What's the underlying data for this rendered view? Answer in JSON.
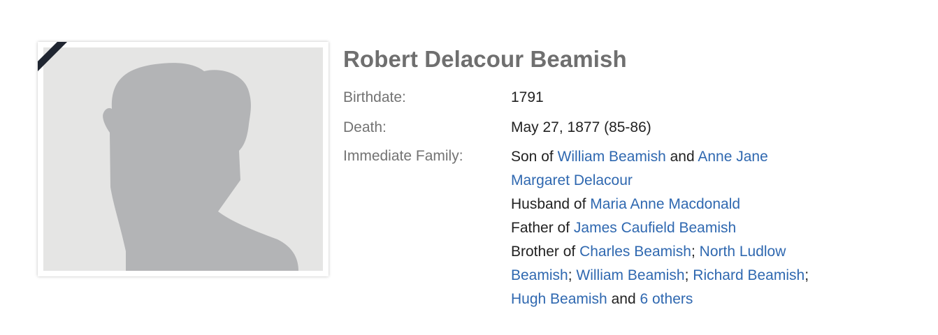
{
  "profile": {
    "name": "Robert Delacour Beamish",
    "birth_label": "Birthdate:",
    "birth_value": "1791",
    "death_label": "Death:",
    "death_value": "May 27, 1877 (85-86)",
    "family_label": "Immediate Family:"
  },
  "family": {
    "son_of_prefix": "Son of",
    "father_name": "William Beamish",
    "and_word": "and",
    "mother_name_line1": "Anne Jane",
    "mother_name_line2": "Margaret Delacour",
    "husband_of_prefix": "Husband of",
    "spouse_name": "Maria Anne Macdonald",
    "father_of_prefix": "Father of",
    "child_name": "James Caufield Beamish",
    "brother_of_prefix": "Brother of",
    "sibling_1": "Charles Beamish",
    "sibling_2_line1": "North Ludlow",
    "sibling_2_line2": "Beamish",
    "sibling_3": "William Beamish",
    "sibling_4": "Richard Beamish",
    "sibling_5": "Hugh Beamish",
    "and_word_2": "and",
    "others_link": "6 others",
    "separator": ";"
  },
  "colors": {
    "link": "#2f68b0",
    "label": "#737373",
    "name": "#6f6f6f",
    "text": "#222222",
    "photo_bg": "#e5e5e4",
    "silhouette": "#b3b4b6",
    "ribbon": "#1f2530"
  },
  "icons": {
    "photo": "person-silhouette-icon",
    "ribbon": "mourning-ribbon-icon"
  }
}
